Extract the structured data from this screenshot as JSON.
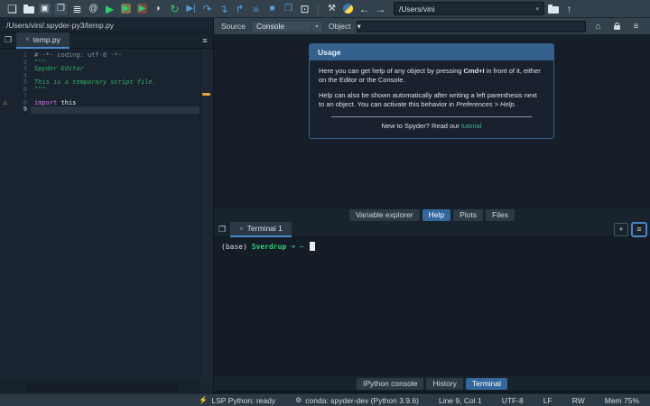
{
  "glyphs": {
    "caret": "▾",
    "close": "×",
    "home": "⌂",
    "menu": "≡",
    "plus": "+",
    "warning": "⚠",
    "up_arrow": "↑",
    "browse_tabs": "❐"
  },
  "toolbar": {
    "cwd_value": "/Users/vini",
    "icons": [
      {
        "name": "new-file-icon",
        "kind": "glyph",
        "glyph": "❏",
        "cls": "big"
      },
      {
        "name": "open-file-icon",
        "kind": "folder"
      },
      {
        "name": "save-file-icon",
        "kind": "glyph",
        "glyph": "▣",
        "cls": "boxed"
      },
      {
        "name": "save-all-icon",
        "kind": "glyph",
        "glyph": "❐",
        "cls": "boxed"
      },
      {
        "name": "file-switcher-icon",
        "kind": "glyph",
        "glyph": "≣",
        "cls": "big"
      },
      {
        "name": "find-symbol-icon",
        "kind": "glyph",
        "glyph": "@",
        "cls": ""
      },
      {
        "name": "run-file-icon",
        "kind": "glyph",
        "glyph": "▶",
        "cls": "green big"
      },
      {
        "name": "run-cell-icon",
        "kind": "glyph",
        "glyph": "▶",
        "cls": "green cellbox"
      },
      {
        "name": "run-cell-advance-icon",
        "kind": "glyph",
        "glyph": "▶",
        "cls": "green cellbox2"
      },
      {
        "name": "run-selection-icon",
        "kind": "glyph",
        "glyph": "◗",
        "cls": ""
      },
      {
        "name": "rerun-cell-icon",
        "kind": "glyph",
        "glyph": "↻",
        "cls": "green big"
      },
      {
        "name": "run-to-line-icon",
        "kind": "glyph",
        "glyph": "▶|",
        "cls": "blue"
      },
      {
        "name": "debug-step-over-icon",
        "kind": "glyph",
        "glyph": "↷",
        "cls": "blue big"
      },
      {
        "name": "debug-step-into-icon",
        "kind": "glyph",
        "glyph": "↴",
        "cls": "blue big"
      },
      {
        "name": "debug-step-out-icon",
        "kind": "glyph",
        "glyph": "↱",
        "cls": "blue big"
      },
      {
        "name": "debug-continue-icon",
        "kind": "glyph",
        "glyph": "»",
        "cls": "blue big"
      },
      {
        "name": "debug-stop-icon",
        "kind": "glyph",
        "glyph": "■",
        "cls": "blue"
      },
      {
        "name": "maximize-pane-icon",
        "kind": "glyph",
        "glyph": "❒",
        "cls": "blue"
      },
      {
        "name": "fullscreen-icon",
        "kind": "glyph",
        "glyph": "⊡",
        "cls": "big"
      },
      {
        "name": "toolbar-separator",
        "kind": "sep"
      },
      {
        "name": "preferences-wrench-icon",
        "kind": "glyph",
        "glyph": "⚒",
        "cls": ""
      },
      {
        "name": "python-env-icon",
        "kind": "python"
      },
      {
        "name": "back-icon",
        "kind": "glyph",
        "glyph": "←",
        "cls": "gray big"
      },
      {
        "name": "forward-icon",
        "kind": "glyph",
        "glyph": "→",
        "cls": "gray big"
      }
    ]
  },
  "editor": {
    "path": "/Users/vini/.spyder-py3/temp.py",
    "tab_label": "temp.py",
    "lines": [
      {
        "n": "1",
        "tokens": [
          [
            "comment",
            "# -*- coding: utf-8 -*-"
          ]
        ]
      },
      {
        "n": "2",
        "tokens": [
          [
            "string",
            "\"\"\""
          ]
        ]
      },
      {
        "n": "3",
        "tokens": [
          [
            "string-em",
            "Spyder Editor"
          ]
        ]
      },
      {
        "n": "4",
        "tokens": []
      },
      {
        "n": "5",
        "tokens": [
          [
            "string-em",
            "This is a temporary script file."
          ]
        ]
      },
      {
        "n": "6",
        "tokens": [
          [
            "string",
            "\"\"\""
          ]
        ]
      },
      {
        "n": "7",
        "tokens": []
      },
      {
        "n": "8",
        "warning": true,
        "tokens": [
          [
            "keyword",
            "import"
          ],
          [
            "plain",
            " this"
          ]
        ]
      },
      {
        "n": "9",
        "current": true,
        "tokens": []
      }
    ]
  },
  "help": {
    "source_label": "Source",
    "source_value": "Console",
    "object_label": "Object",
    "object_value": "",
    "usage": {
      "title": "Usage",
      "paragraph1": [
        [
          "t",
          "Here you can get help of any object by pressing "
        ],
        [
          "b",
          "Cmd+I"
        ],
        [
          "t",
          " in front of it, either on the Editor or the Console."
        ]
      ],
      "paragraph2": [
        [
          "t",
          "Help can also be shown automatically after writing a left parenthesis next to an object. You can activate this behavior in "
        ],
        [
          "i",
          "Preferences > Help"
        ],
        [
          "t",
          "."
        ]
      ],
      "footer": [
        [
          "t",
          "New to Spyder? Read our "
        ],
        [
          "link",
          "tutorial"
        ]
      ]
    },
    "tabs": [
      "Variable explorer",
      "Help",
      "Plots",
      "Files"
    ],
    "active_tab": "Help"
  },
  "terminal": {
    "tab_label": "Terminal 1",
    "prompt": [
      [
        "fg",
        "(base) "
      ],
      [
        "green",
        "Sverdrup"
      ],
      [
        "green",
        " ➜ "
      ],
      [
        "cyan",
        " ~ "
      ]
    ],
    "tabs": [
      "IPython console",
      "History",
      "Terminal"
    ],
    "active_tab": "Terminal"
  },
  "statusbar": {
    "items": [
      {
        "name": "lsp-status",
        "icon": "lsp-icon",
        "glyph": "⚡",
        "label": "LSP Python: ready",
        "interactable": true
      },
      {
        "name": "conda-env-status",
        "icon": "conda-icon",
        "glyph": "⚙",
        "label": "conda: spyder-dev (Python 3.9.6)",
        "interactable": true
      },
      {
        "name": "cursor-position",
        "label": "Line 9, Col 1",
        "interactable": false
      },
      {
        "name": "encoding",
        "label": "UTF-8",
        "interactable": false
      },
      {
        "name": "eol-status",
        "label": "LF",
        "interactable": false
      },
      {
        "name": "permissions",
        "label": "RW",
        "interactable": false
      },
      {
        "name": "memory-usage",
        "label": "Mem 75%",
        "interactable": false
      }
    ]
  },
  "colors": {
    "toolbar_bg": "#32414b",
    "panel_bg": "#19232d",
    "dark_bg": "#141c26",
    "accent_blue": "#34679a",
    "usage_header": "#33608d",
    "link": "#3cb390",
    "string_green": "#2fae62",
    "keyword_purple": "#c678dd",
    "terminal_green": "#2fd178",
    "terminal_cyan": "#4fc3d6",
    "scroll_flag_orange": "#e8a33d",
    "warning_orange": "#e3a72f"
  }
}
